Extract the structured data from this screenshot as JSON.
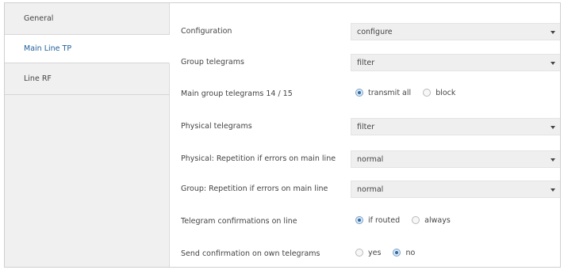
{
  "sidebar": {
    "tabs": [
      {
        "label": "General"
      },
      {
        "label": "Main Line TP"
      },
      {
        "label": "Line RF"
      }
    ]
  },
  "settings": [
    {
      "label": "Configuration",
      "value": "configure"
    },
    {
      "label": "Group telegrams",
      "value": "filter"
    },
    {
      "label": "Main group telegrams 14 / 15",
      "options": [
        "transmit all",
        "block"
      ],
      "selected": "transmit all"
    },
    {
      "label": "Physical telegrams",
      "value": "filter"
    },
    {
      "label": "Physical: Repetition if errors on main line",
      "value": "normal"
    },
    {
      "label": "Group: Repetition if errors on main line",
      "value": "normal"
    },
    {
      "label": "Telegram confirmations on line",
      "options": [
        "if routed",
        "always"
      ],
      "selected": "if routed"
    },
    {
      "label": "Send confirmation on own telegrams",
      "options": [
        "yes",
        "no"
      ],
      "selected": "no"
    }
  ],
  "colors": {
    "active_tab_text": "#1f5f9c",
    "sidebar_bg": "#f0f0f0",
    "dropdown_bg": "#efefef"
  }
}
